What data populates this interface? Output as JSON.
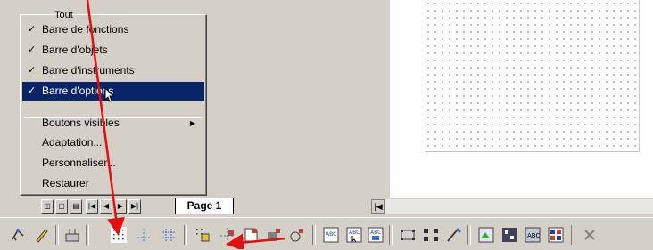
{
  "menu": {
    "top_partial_label": "Tout",
    "items": [
      {
        "label": "Barre de fonctions",
        "checked": true
      },
      {
        "label": "Barre d'objets",
        "checked": true
      },
      {
        "label": "Barre d'instruments",
        "checked": true
      },
      {
        "label": "Barre d'options",
        "checked": true,
        "selected": true
      },
      {
        "label": "Boutons visibles",
        "has_submenu": true
      },
      {
        "label": "Adaptation..."
      },
      {
        "label": "Personnaliser..."
      },
      {
        "label": "Restaurer"
      }
    ],
    "check_glyph": "✓",
    "submenu_arrow": "▶"
  },
  "tabs": {
    "page_tab_label": "Page 1",
    "nav_icons": [
      "view-normal-icon",
      "view-master-icon",
      "view-layer-icon",
      "first-page-icon",
      "prev-page-icon",
      "next-page-icon",
      "last-page-icon"
    ],
    "nav_glyphs": [
      "◫",
      "▢",
      "▤",
      "|◀",
      "◀",
      "▶",
      "▶|"
    ],
    "scroll_glyph": "|◀"
  },
  "colors": {
    "highlight": "#0a246a",
    "face": "#d4d0c8",
    "annotation_arrow": "#e01010"
  }
}
